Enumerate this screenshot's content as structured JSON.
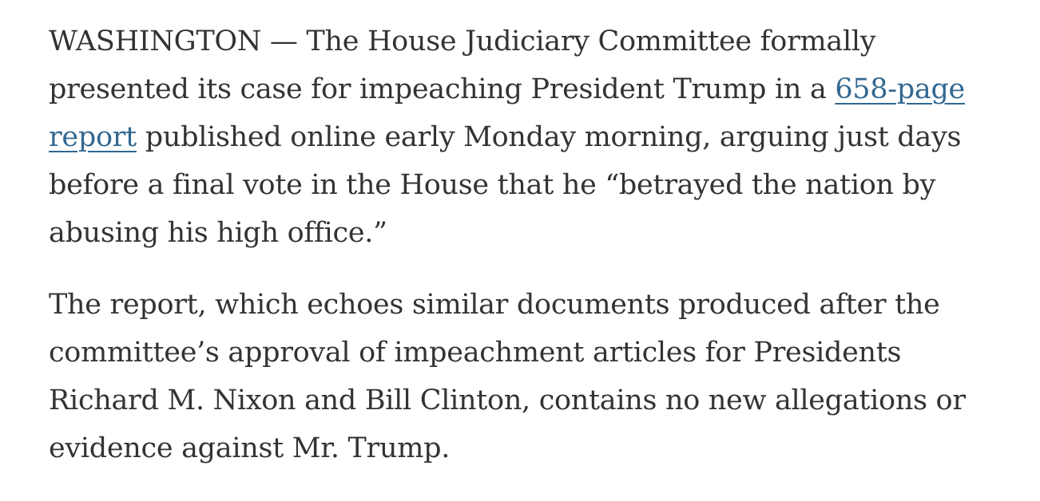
{
  "article": {
    "paragraph_1": {
      "line_1": "WASHINGTON — The House Judiciary Committee formally",
      "line_2_before_link": "presented its case for impeaching President Trump in a ",
      "link_text_part_1": "658-page",
      "link_text_part_2": "report",
      "line_3_after_link": " published online early Monday morning, arguing just days",
      "line_4": "before a final vote in the House that he “betrayed the nation by",
      "line_5": "abusing his high office.”"
    },
    "paragraph_2": {
      "line_1": "The report, which echoes similar documents produced after the",
      "line_2": "committee’s approval of impeachment articles for Presidents",
      "line_3": "Richard M. Nixon and Bill Clinton, contains no new allegations or",
      "line_4": "evidence against Mr. Trump."
    }
  },
  "colors": {
    "text": "#333333",
    "link": "#326891",
    "background": "#ffffff"
  }
}
